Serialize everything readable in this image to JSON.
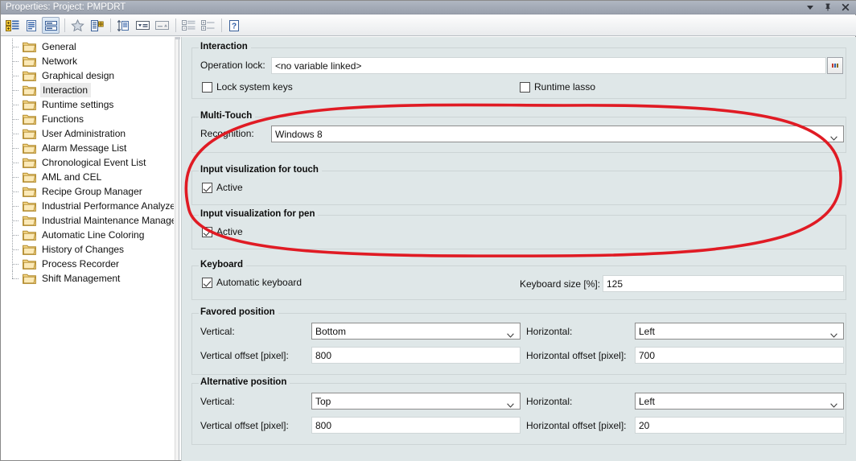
{
  "window": {
    "title": "Properties: Project: PMPDRT",
    "controls": [
      {
        "name": "chevron-down-icon",
        "label": "Dropdown"
      },
      {
        "name": "pin-icon",
        "label": "Pin"
      },
      {
        "name": "close-icon",
        "label": "Close"
      }
    ]
  },
  "toolbar": {
    "items": [
      {
        "name": "categorized-view-button",
        "label": "Categorized",
        "pressed": false
      },
      {
        "name": "properties-page-button",
        "label": "Property Pages",
        "pressed": false
      },
      {
        "name": "grouped-view-button",
        "label": "Grouped View",
        "pressed": true
      },
      {
        "name": "favorites-button",
        "label": "Favorites",
        "pressed": false
      },
      {
        "name": "compare-button",
        "label": "Compare",
        "pressed": false
      },
      {
        "name": "resize-height-button",
        "label": "Auto Height",
        "pressed": false
      },
      {
        "name": "sort-descending-button",
        "label": "Sort Descending",
        "pressed": false
      },
      {
        "name": "sort-ascending-button",
        "label": "Sort Ascending",
        "pressed": false
      },
      {
        "name": "collapse-all-button",
        "label": "Collapse All",
        "pressed": false
      },
      {
        "name": "expand-all-button",
        "label": "Expand All",
        "pressed": false
      },
      {
        "name": "help-button",
        "label": "Help",
        "pressed": false
      }
    ]
  },
  "sidebar": {
    "selected": "Interaction",
    "items": [
      {
        "label": "General"
      },
      {
        "label": "Network"
      },
      {
        "label": "Graphical design"
      },
      {
        "label": "Interaction"
      },
      {
        "label": "Runtime settings"
      },
      {
        "label": "Functions"
      },
      {
        "label": "User Administration"
      },
      {
        "label": "Alarm Message List"
      },
      {
        "label": "Chronological Event List"
      },
      {
        "label": "AML and CEL"
      },
      {
        "label": "Recipe Group Manager"
      },
      {
        "label": "Industrial Performance Analyzer"
      },
      {
        "label": "Industrial Maintenance Manager"
      },
      {
        "label": "Automatic Line Coloring"
      },
      {
        "label": "History of Changes"
      },
      {
        "label": "Process Recorder"
      },
      {
        "label": "Shift Management"
      }
    ]
  },
  "main": {
    "interaction": {
      "legend": "Interaction",
      "operation_lock_label": "Operation lock:",
      "operation_lock_value": "<no variable linked>",
      "browse_label": "...",
      "lock_system_keys_label": "Lock system keys",
      "lock_system_keys_checked": false,
      "runtime_lasso_label": "Runtime lasso",
      "runtime_lasso_checked": false
    },
    "multitouch": {
      "legend": "Multi-Touch",
      "recognition_label": "Recognition:",
      "recognition_value": "Windows 8"
    },
    "touch_visualization": {
      "legend": "Input visulization for touch",
      "active_label": "Active",
      "active_checked": true
    },
    "pen_visualization": {
      "legend": "Input visualization for pen",
      "active_label": "Active",
      "active_checked": true
    },
    "keyboard": {
      "legend": "Keyboard",
      "automatic_keyboard_label": "Automatic keyboard",
      "automatic_keyboard_checked": true,
      "keyboard_size_label": "Keyboard size [%]:",
      "keyboard_size_value": "125"
    },
    "favored_position": {
      "legend": "Favored position",
      "vertical_label": "Vertical:",
      "vertical_value": "Bottom",
      "horizontal_label": "Horizontal:",
      "horizontal_value": "Left",
      "vertical_offset_label": "Vertical offset  [pixel]:",
      "vertical_offset_value": "800",
      "horizontal_offset_label": "Horizontal offset [pixel]:",
      "horizontal_offset_value": "700"
    },
    "alternative_position": {
      "legend": "Alternative position",
      "vertical_label": "Vertical:",
      "vertical_value": "Top",
      "horizontal_label": "Horizontal:",
      "horizontal_value": "Left",
      "vertical_offset_label": "Vertical offset  [pixel]:",
      "vertical_offset_value": "800",
      "horizontal_offset_label": "Horizontal offset [pixel]:",
      "horizontal_offset_value": "20"
    }
  },
  "annotation": {
    "name": "red-highlight-ellipse",
    "color": "#e01b24"
  }
}
